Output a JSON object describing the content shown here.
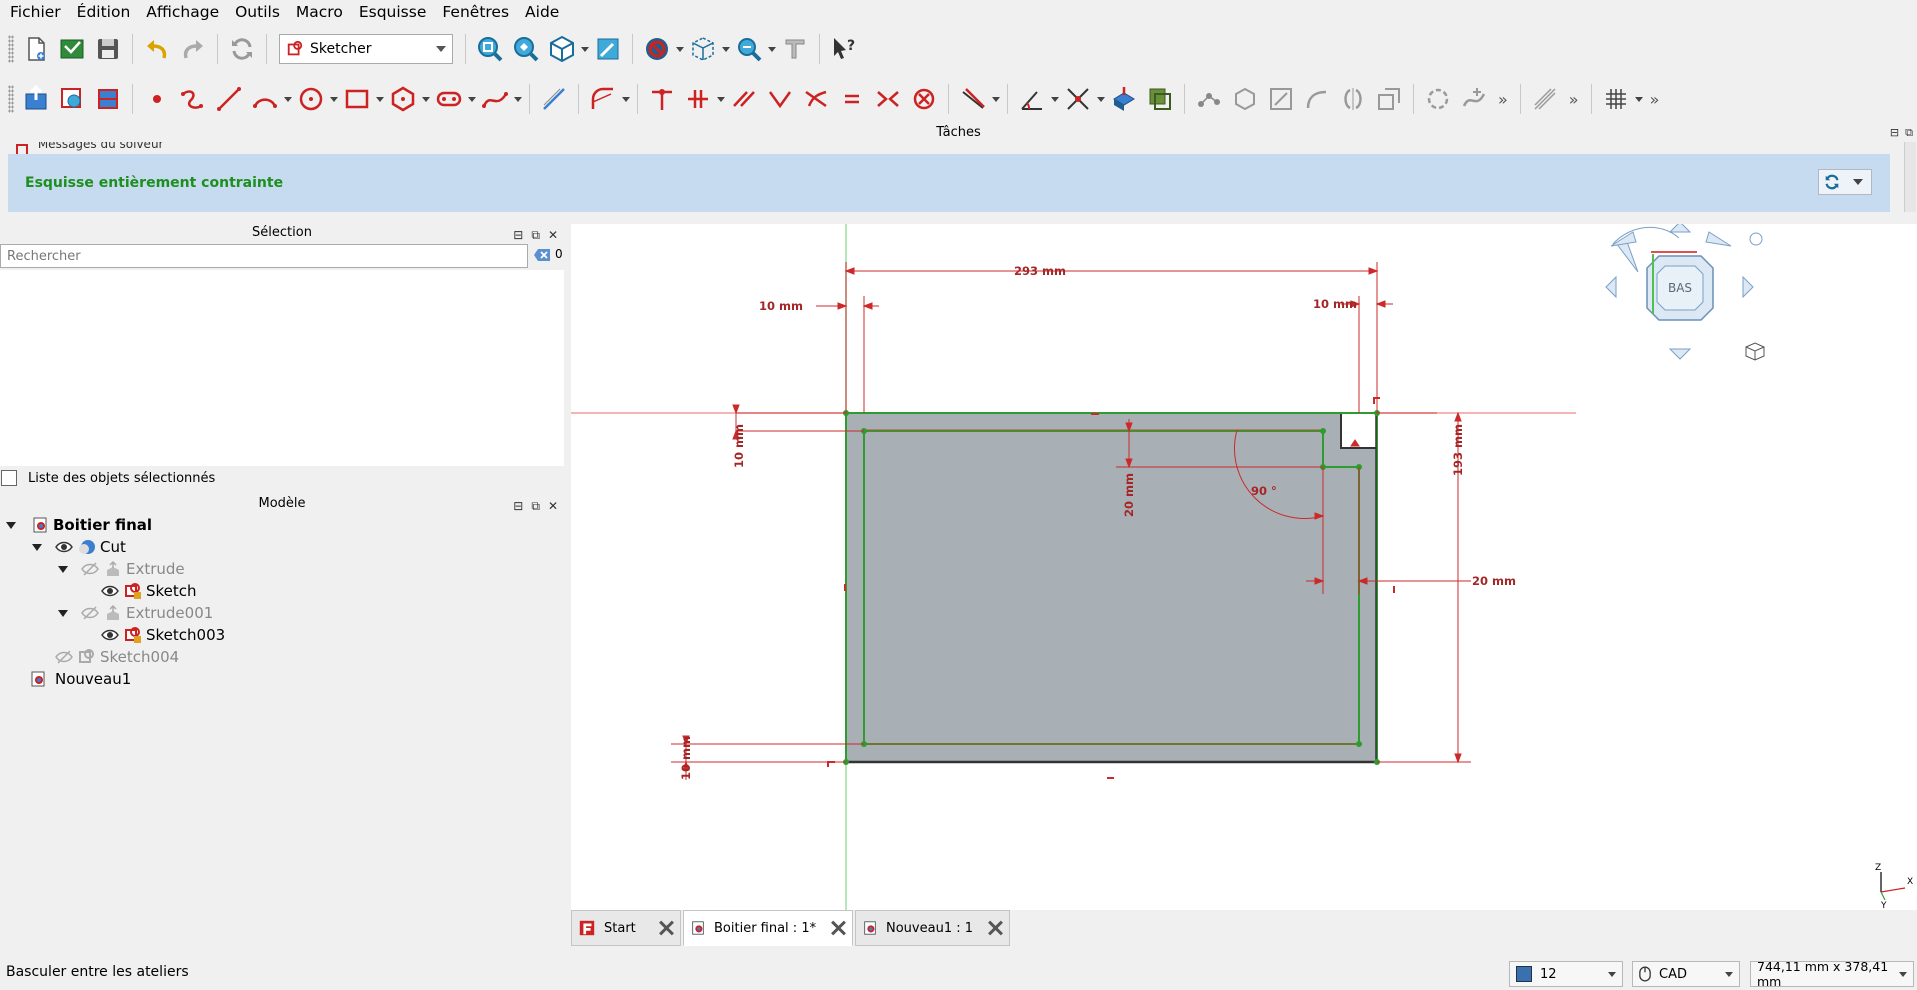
{
  "menu": [
    "Fichier",
    "Édition",
    "Affichage",
    "Outils",
    "Macro",
    "Esquisse",
    "Fenêtres",
    "Aide"
  ],
  "toolbar": {
    "workbench": "Sketcher"
  },
  "tasks": {
    "title": "Tâches",
    "solver_title": "Messages du solveur",
    "message": "Esquisse entièrement contrainte"
  },
  "selection": {
    "title": "Sélection",
    "search_placeholder": "Rechercher",
    "count": "0",
    "list_label": "Liste des objets sélectionnés"
  },
  "model": {
    "title": "Modèle",
    "tree": [
      {
        "label": "Boitier final",
        "bold": true
      },
      {
        "label": "Cut"
      },
      {
        "label": "Extrude",
        "dim": true
      },
      {
        "label": "Sketch"
      },
      {
        "label": "Extrude001",
        "dim": true
      },
      {
        "label": "Sketch003"
      },
      {
        "label": "Sketch004",
        "dim": true
      },
      {
        "label": "Nouveau1"
      }
    ]
  },
  "viewport": {
    "navcube_face": "BAS",
    "dims": {
      "width": "293 mm",
      "left_offset": "10 mm",
      "right_offset": "10 mm",
      "height": "193 mm",
      "top_offset": "10 mm",
      "bottom_offset": "10 mm",
      "inner_depth": "20 mm",
      "angle": "90 °",
      "right_width": "20 mm"
    },
    "axes": {
      "z": "Z",
      "x": "X",
      "y": "Y"
    }
  },
  "doc_tabs": [
    {
      "label": "Start"
    },
    {
      "label": "Boitier final : 1*",
      "active": true
    },
    {
      "label": "Nouveau1 : 1"
    }
  ],
  "status": {
    "text": "Basculer entre les ateliers",
    "value": "12",
    "nav_style": "CAD",
    "dimensions": "744,11 mm x 378,41 mm"
  },
  "colors": {
    "constraint": "#cc2a2a",
    "sketch_green": "#2e9c2e",
    "face": "#a9b0b5"
  }
}
